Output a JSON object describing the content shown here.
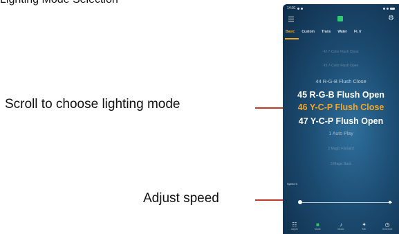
{
  "top_text": "Lighting Mode Selection",
  "callouts": {
    "scroll": "Scroll to choose lighting mode",
    "speed": "Adjust speed"
  },
  "accent_color": "#f5a623",
  "callout_line_color": "#c0392b",
  "status_bar": {
    "time": "14:01"
  },
  "tabs": [
    {
      "label": "Basic",
      "active": true
    },
    {
      "label": "Custom"
    },
    {
      "label": "Trans"
    },
    {
      "label": "Water"
    },
    {
      "label": "Fl. Ir"
    }
  ],
  "modes": [
    "42 7-Color Flush Close",
    "43 7-Color Flush Open",
    "44 R-G-B Flush Close",
    "45 R-G-B Flush Open",
    "46 Y-C-P Flush Close",
    "47 Y-C-P Flush Open",
    "1 Auto Play",
    "2 Magic Forward",
    "3 Magic Back"
  ],
  "selected_mode_index": 4,
  "speed": {
    "label": "Speed 0",
    "value_fraction": 0.0
  },
  "bottom_nav": [
    {
      "label": "Adjust",
      "icon": "sliders-icon"
    },
    {
      "label": "Mode",
      "icon": "grid-icon",
      "active": true
    },
    {
      "label": "Music",
      "icon": "music-icon"
    },
    {
      "label": "Mic",
      "icon": "mic-icon"
    },
    {
      "label": "Schedule",
      "icon": "clock-icon"
    }
  ]
}
